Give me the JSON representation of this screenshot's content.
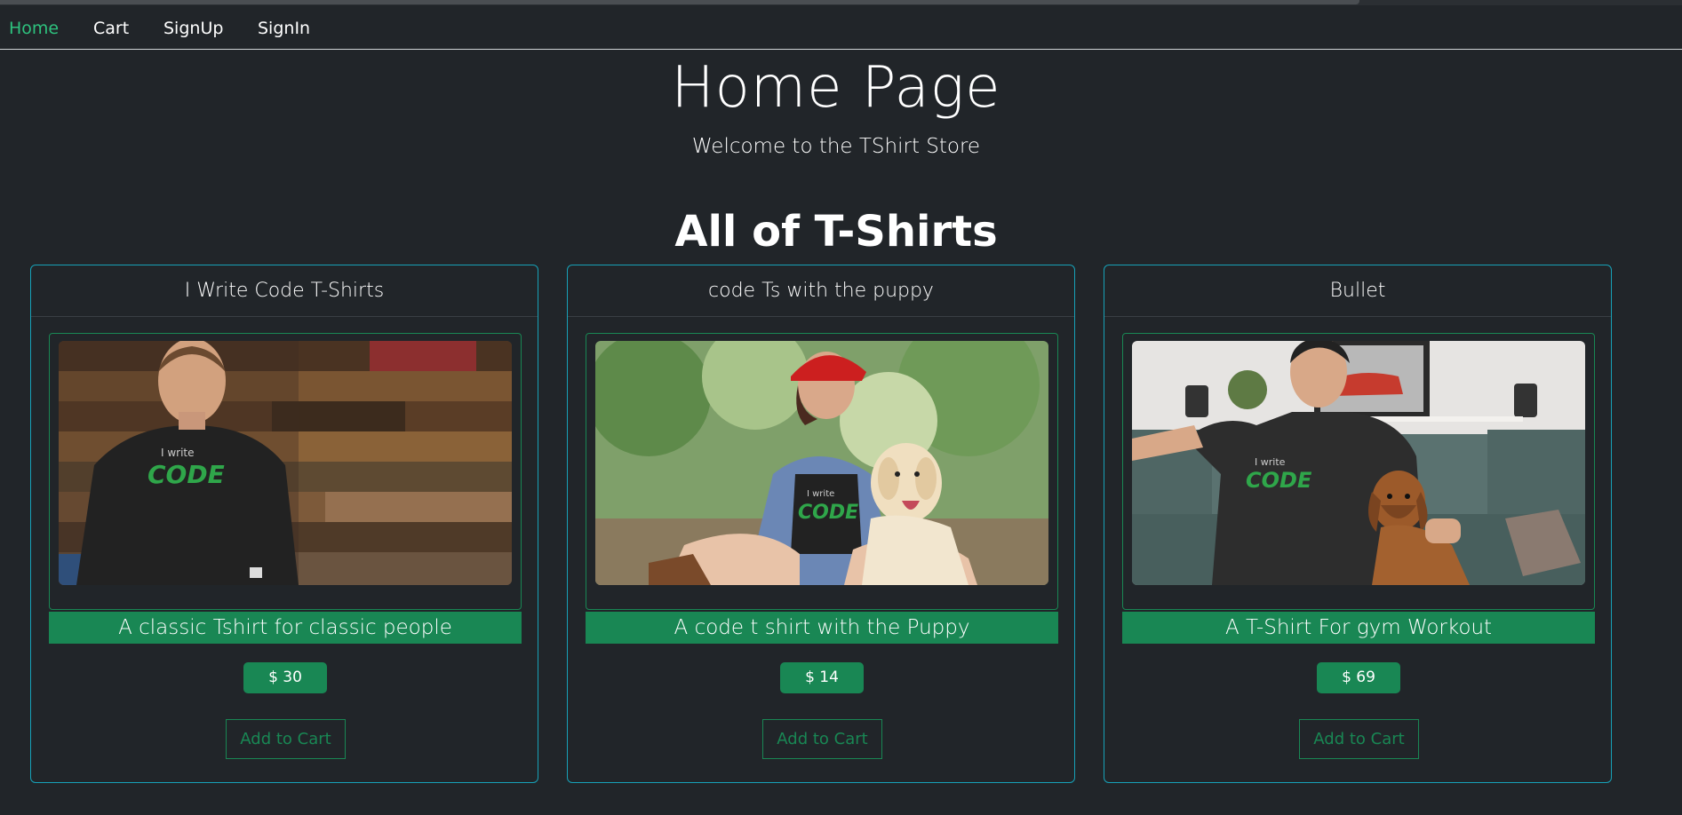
{
  "nav": {
    "items": [
      {
        "label": "Home",
        "active": true
      },
      {
        "label": "Cart",
        "active": false
      },
      {
        "label": "SignUp",
        "active": false
      },
      {
        "label": "SignIn",
        "active": false
      }
    ]
  },
  "hero": {
    "title": "Home Page",
    "subtitle": "Welcome to the TShirt Store"
  },
  "section": {
    "title": "All of T-Shirts"
  },
  "products": [
    {
      "name": "I Write Code T-Shirts",
      "description": "A classic Tshirt for classic people",
      "price": "$ 30",
      "button": "Add to Cart",
      "image_alt": "man in black I write CODE t-shirt against wooden wall"
    },
    {
      "name": "code Ts with the puppy",
      "description": "A code t shirt with the Puppy",
      "price": "$ 14",
      "button": "Add to Cart",
      "image_alt": "woman in red hat and I write CODE t-shirt with a labrador"
    },
    {
      "name": "Bullet",
      "description": "A T-Shirt For gym Workout",
      "price": "$ 69",
      "button": "Add to Cart",
      "image_alt": "man on sofa in I write CODE t-shirt with a dachshund"
    }
  ],
  "colors": {
    "background": "#212529",
    "accent_green": "#198754",
    "active_nav": "#2ec27e",
    "card_border": "#17a2b8"
  }
}
